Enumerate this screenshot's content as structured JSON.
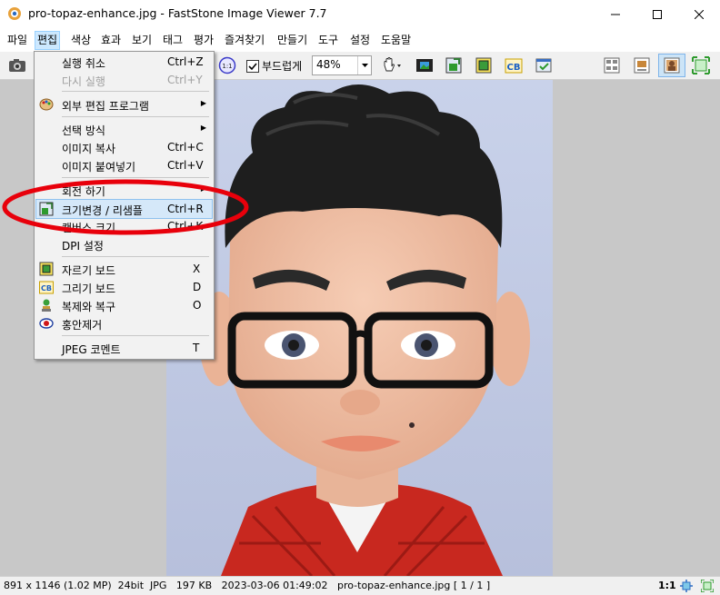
{
  "window": {
    "title": "pro-topaz-enhance.jpg  -  FastStone Image Viewer 7.7",
    "app_icon": "faststone-icon",
    "controls": [
      "minimize-icon",
      "maximize-icon",
      "close-icon"
    ]
  },
  "menubar": {
    "items": [
      "파일",
      "편집",
      "색상",
      "효과",
      "보기",
      "태그",
      "평가",
      "즐겨찾기",
      "만들기",
      "도구",
      "설정",
      "도움말"
    ],
    "active_index": 1
  },
  "toolbar": {
    "smooth_label": "부드럽게",
    "smooth_checked": true,
    "zoom_value": "48%"
  },
  "edit_menu": {
    "items": [
      {
        "label": "실행 취소",
        "shortcut": "Ctrl+Z",
        "icon": "",
        "disabled": false
      },
      {
        "label": "다시 실행",
        "shortcut": "Ctrl+Y",
        "icon": "",
        "disabled": true
      },
      {
        "label": "외부 편집 프로그램",
        "shortcut": "",
        "icon": "palette-icon",
        "submenu": true
      },
      {
        "label": "선택 방식",
        "shortcut": "",
        "icon": "",
        "submenu": true
      },
      {
        "label": "이미지 복사",
        "shortcut": "Ctrl+C",
        "icon": ""
      },
      {
        "label": "이미지 붙여넣기",
        "shortcut": "Ctrl+V",
        "icon": ""
      },
      {
        "label": "회전 하기",
        "shortcut": "",
        "icon": "",
        "submenu": true
      },
      {
        "label": "크기변경 / 리샘플",
        "shortcut": "Ctrl+R",
        "icon": "resize-icon",
        "highlighted": true
      },
      {
        "label": "캔버스 크기",
        "shortcut": "Ctrl+K",
        "icon": ""
      },
      {
        "label": "DPI 설정",
        "shortcut": "",
        "icon": ""
      },
      {
        "label": "자르기 보드",
        "shortcut": "X",
        "icon": "crop-icon"
      },
      {
        "label": "그리기 보드",
        "shortcut": "D",
        "icon": "draw-icon"
      },
      {
        "label": "복제와 복구",
        "shortcut": "O",
        "icon": "clone-icon"
      },
      {
        "label": "홍안제거",
        "shortcut": "",
        "icon": "red-eye-icon"
      },
      {
        "label": "JPEG 코멘트",
        "shortcut": "T",
        "icon": ""
      }
    ]
  },
  "status": {
    "text": "891 x 1146 (1.02 MP)  24bit  JPG   197 KB   2023-03-06 01:49:02   pro-topaz-enhance.jpg [ 1 / 1 ]",
    "ratio": "1:1"
  },
  "colors": {
    "menu_highlight": "#d5e8f9",
    "annotation": "#e8000b",
    "viewer_bg": "#c8c8c8"
  }
}
